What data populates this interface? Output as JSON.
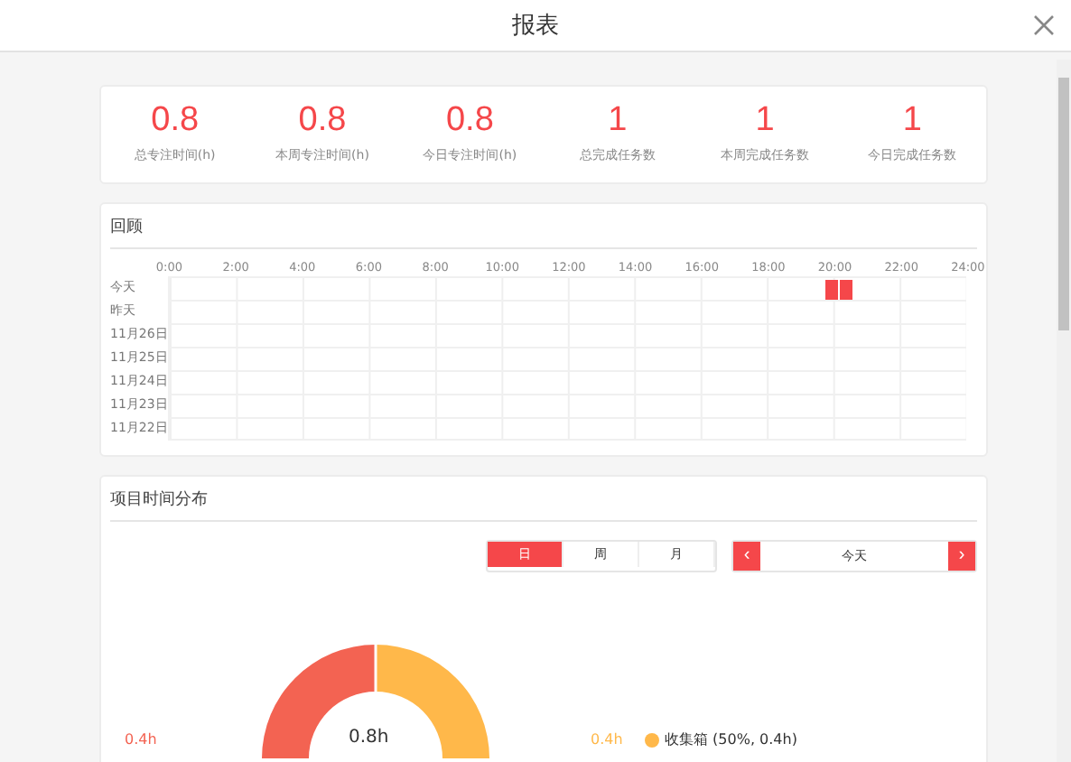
{
  "window": {
    "title": "报表"
  },
  "stats": [
    {
      "value": "0.8",
      "label": "总专注时间(h)"
    },
    {
      "value": "0.8",
      "label": "本周专注时间(h)"
    },
    {
      "value": "0.8",
      "label": "今日专注时间(h)"
    },
    {
      "value": "1",
      "label": "总完成任务数"
    },
    {
      "value": "1",
      "label": "本周完成任务数"
    },
    {
      "value": "1",
      "label": "今日完成任务数"
    }
  ],
  "review": {
    "title": "回顾",
    "hours": [
      "0:00",
      "2:00",
      "4:00",
      "6:00",
      "8:00",
      "10:00",
      "12:00",
      "14:00",
      "16:00",
      "18:00",
      "20:00",
      "22:00",
      "24:00"
    ],
    "rows": [
      "今天",
      "昨天",
      "11月26日",
      "11月25日",
      "11月24日",
      "11月23日",
      "11月22日"
    ]
  },
  "distribution": {
    "title": "项目时间分布",
    "periods": [
      {
        "label": "日",
        "selected": true
      },
      {
        "label": "周",
        "selected": false
      },
      {
        "label": "月",
        "selected": false
      }
    ],
    "prev": "‹",
    "date": "今天",
    "next": "›",
    "left_value": "0.4h",
    "right_value": "0.4h",
    "center_value": "0.8h",
    "legend": [
      {
        "text": "收集箱 (50%, 0.4h)",
        "color": "#ffb84a"
      }
    ]
  }
}
